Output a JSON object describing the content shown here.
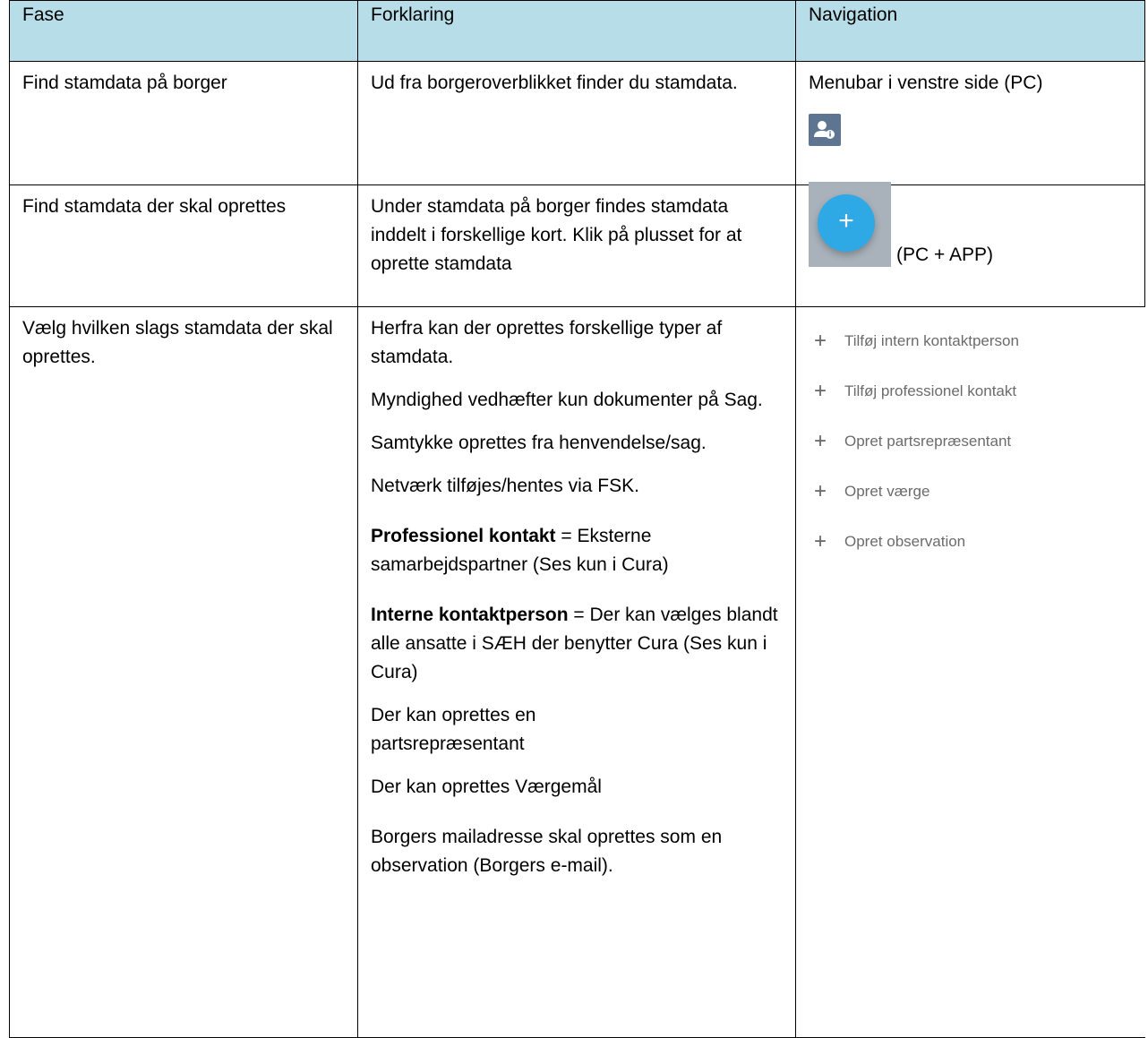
{
  "headers": {
    "fase": "Fase",
    "forklaring": "Forklaring",
    "navigation": "Navigation"
  },
  "rows": [
    {
      "fase": "Find stamdata på borger",
      "forklaring": "Ud fra borgeroverblikket finder du stamdata.",
      "navigation_text": "Menubar i venstre side (PC)",
      "navigation_icon": "person-info-icon"
    },
    {
      "fase": "Find stamdata der skal oprettes",
      "forklaring": "Under stamdata på borger findes stamdata inddelt i forskellige kort. Klik på plusset for at oprette stamdata",
      "navigation_fab": "+",
      "navigation_text": "(PC + APP)"
    },
    {
      "fase": "Vælg hvilken slags stamdata der skal oprettes.",
      "forklaring": {
        "p1": "Herfra kan der oprettes forskellige typer af stamdata.",
        "p2": "Myndighed vedhæfter kun dokumenter på Sag.",
        "p3": "Samtykke oprettes fra henvendelse/sag.",
        "p4": "Netværk tilføjes/hentes via FSK.",
        "p5_bold": "Professionel kontakt",
        "p5_rest": " = Eksterne samarbejdspartner (Ses kun i Cura)",
        "p6_bold": "Interne kontaktperson",
        "p6_rest": " = Der kan vælges blandt alle ansatte i SÆH der benytter Cura (Ses kun i Cura)",
        "p7": "Der kan oprettes en partsrepræsentant",
        "p8": "Der kan oprettes Værgemål",
        "p9": "Borgers mailadresse skal oprettes som en observation (Borgers e-mail)."
      },
      "menu_items": [
        "Tilføj intern kontaktperson",
        "Tilføj professionel kontakt",
        "Opret partsrepræsentant",
        "Opret værge",
        "Opret observation"
      ]
    }
  ],
  "colors": {
    "header_bg": "#b6dde8",
    "fab": "#2fa9e6",
    "nav_icon_bg": "#5d7590"
  }
}
